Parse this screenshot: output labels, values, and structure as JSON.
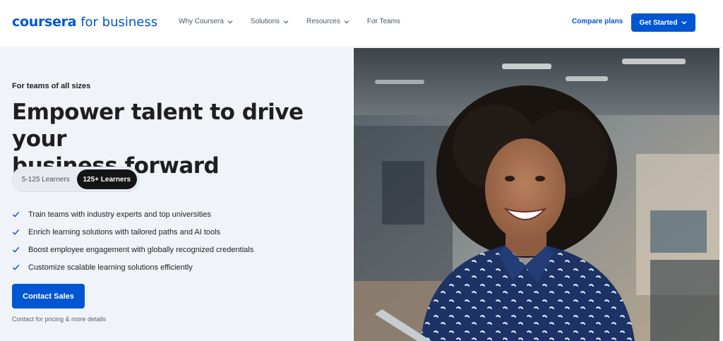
{
  "header": {
    "logo_text": "coursera",
    "logo_sub": "for business",
    "nav": [
      {
        "label": "Why Coursera",
        "has_dropdown": true
      },
      {
        "label": "Solutions",
        "has_dropdown": true
      },
      {
        "label": "Resources",
        "has_dropdown": true
      },
      {
        "label": "For Teams",
        "has_dropdown": false
      }
    ],
    "compare_label": "Compare plans",
    "cta_label": "Get Started"
  },
  "hero": {
    "eyebrow": "For teams of all sizes",
    "headline_line1": "Empower talent to drive your",
    "headline_line2": "business forward",
    "toggle": {
      "options": [
        "5-125 Learners",
        "125+ Learners"
      ],
      "selected": "125+ Learners"
    },
    "bullets": [
      "Train teams with industry experts and top universities",
      "Enrich learning solutions with tailored paths and AI tools",
      "Boost employee engagement with globally recognized credentials",
      "Customize scalable learning solutions efficiently"
    ],
    "cta_label": "Contact Sales",
    "cta_note": "Contact for pricing & more details"
  },
  "colors": {
    "brand": "#0056d2",
    "hero_bg": "#f0f3f8",
    "toggle_selected": "#141414"
  },
  "icons": [
    "chevron-down-icon",
    "check-icon"
  ]
}
